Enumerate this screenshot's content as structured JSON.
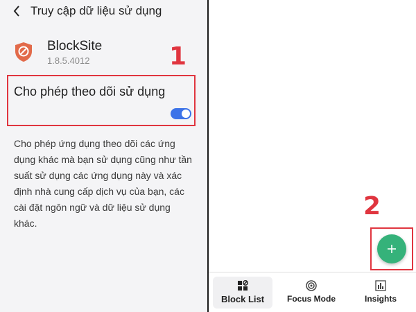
{
  "left_panel": {
    "header": {
      "title": "Truy cập dữ liệu sử dụng"
    },
    "app": {
      "name": "BlockSite",
      "version": "1.8.5.4012"
    },
    "toggle": {
      "label": "Cho phép theo dõi sử dụng",
      "state": "on"
    },
    "description": "Cho phép ứng dụng theo dõi các ứng dụng khác mà bạn sử dụng cũng như tần suất sử dụng các ứng dụng này và xác định nhà cung cấp dịch vụ của bạn, các cài đặt ngôn ngữ và dữ liệu sử dụng khác."
  },
  "right_panel": {
    "fab": {
      "icon": "plus-icon",
      "color": "#35b27a"
    },
    "bottom_nav": [
      {
        "label": "Block List",
        "icon": "block-list-icon",
        "active": true
      },
      {
        "label": "Focus Mode",
        "icon": "focus-target-icon",
        "active": false
      },
      {
        "label": "Insights",
        "icon": "bar-chart-icon",
        "active": false
      }
    ]
  },
  "annotations": {
    "step1": "1",
    "step2": "2"
  },
  "colors": {
    "highlight_red": "#e0353f",
    "toggle_blue": "#3d73e8",
    "fab_green": "#35b27a"
  }
}
